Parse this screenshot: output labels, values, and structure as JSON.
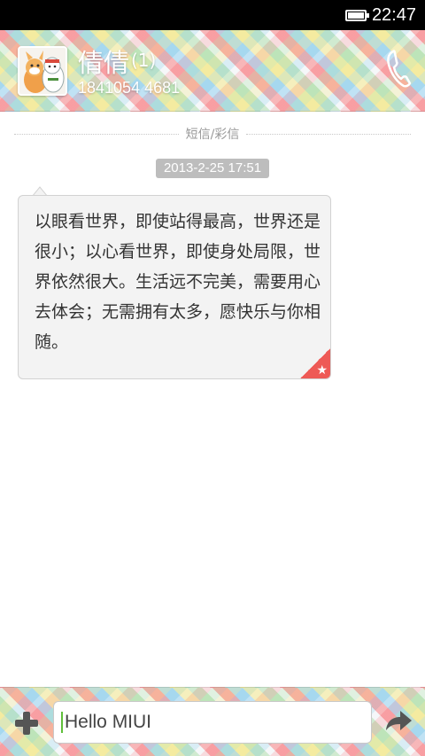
{
  "status_bar": {
    "time": "22:47",
    "battery_icon": "battery-icon"
  },
  "header": {
    "contact_name": "倩倩",
    "unread_count": "(1)",
    "contact_number": "1841054 4681",
    "avatar_icon": "avatar-cartoon-icon",
    "call_icon": "phone-icon"
  },
  "thread": {
    "divider_label": "短信/彩信",
    "timestamp": "2013-2-25 17:51",
    "messages": [
      {
        "text": "以眼看世界，即使站得最高，世界还是很小；以心看世界，即使身处局限，世界依然很大。生活远不完美，需要用心去体会；无需拥有太多，愿快乐与你相随。",
        "starred": true,
        "star_icon": "star-icon"
      }
    ]
  },
  "composer": {
    "add_icon": "plus-icon",
    "input_value": "Hello MIUI",
    "send_icon": "send-arrow-icon"
  },
  "colors": {
    "star_corner": "#ee5a56",
    "caret": "#5fbf3a",
    "timestamp_bg": "#bdbdbd"
  }
}
